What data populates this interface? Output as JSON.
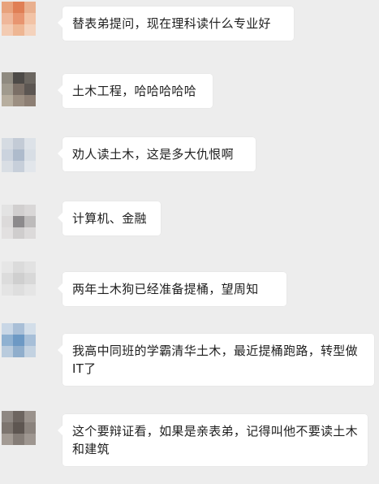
{
  "messages": [
    {
      "text": "替表弟提问，现在理科读什么专业好",
      "avatar": "avatar-1"
    },
    {
      "text": "土木工程，哈哈哈哈哈",
      "avatar": "avatar-2"
    },
    {
      "text": "劝人读土木，这是多大仇恨啊",
      "avatar": "avatar-3"
    },
    {
      "text": "计算机、金融",
      "avatar": "avatar-4"
    },
    {
      "text": "两年土木狗已经准备提桶，望周知",
      "avatar": "avatar-5"
    },
    {
      "text": "我高中同班的学霸清华土木，最近提桶跑路，转型做IT了",
      "avatar": "avatar-6"
    },
    {
      "text": "这个要辩证看，如果是亲表弟，记得叫他不要读土木和建筑",
      "avatar": "avatar-7"
    }
  ],
  "avatar_colors": {
    "avatar-1": [
      "#e8a27c",
      "#e07f55",
      "#e9b08f",
      "#efb79a",
      "#e89570",
      "#f2c3a6",
      "#f3cbb2",
      "#eeb693",
      "#f4d2bc"
    ],
    "avatar-2": [
      "#8f8a80",
      "#4d4a47",
      "#6b6660",
      "#a09a8e",
      "#7b6f66",
      "#5c5652",
      "#b7ae9f",
      "#9c8f82",
      "#8d7f74"
    ],
    "avatar-3": [
      "#d5dbe2",
      "#c3cbd6",
      "#dde2e8",
      "#cbd3de",
      "#aebbcc",
      "#d8dee5",
      "#d9dee4",
      "#c7cfda",
      "#e2e6eb"
    ],
    "avatar-4": [
      "#e3e3e3",
      "#d1cfcf",
      "#d9d7d7",
      "#dcdada",
      "#8c8a8c",
      "#bdbbbb",
      "#e2e0e0",
      "#cfcdcd",
      "#dcdada"
    ],
    "avatar-5": [
      "#e6e6e6",
      "#dbdbdb",
      "#e2e2e2",
      "#dcdcdc",
      "#cfcfcf",
      "#d8d8d8",
      "#e4e4e4",
      "#dedede",
      "#e5e5e5"
    ],
    "avatar-6": [
      "#c9d7e6",
      "#a9bfd7",
      "#d3dee9",
      "#8fb1d1",
      "#6d99c4",
      "#a7bfd8",
      "#b9cbdd",
      "#90aecc",
      "#c3d2e1"
    ],
    "avatar-7": [
      "#8e8782",
      "#6d6560",
      "#9a928c",
      "#7d756f",
      "#5e5651",
      "#8b837d",
      "#a39b94",
      "#857d77",
      "#9e9690"
    ]
  }
}
